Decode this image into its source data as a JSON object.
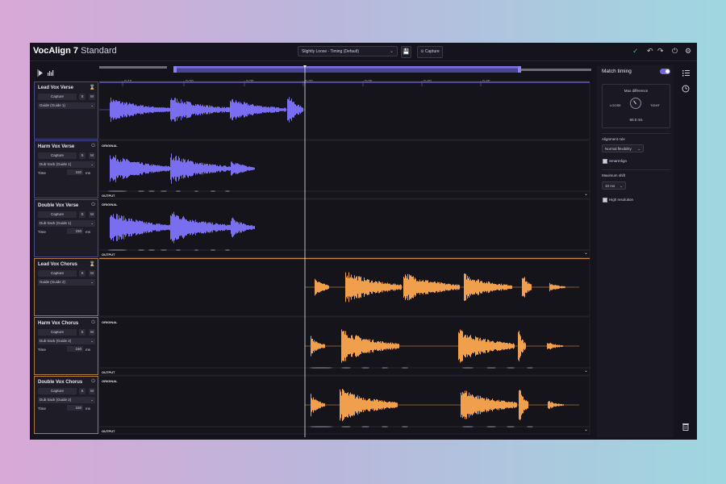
{
  "app": {
    "name_bold": "VocAlign 7",
    "edition": "Standard"
  },
  "toolbar": {
    "preset": "Slightly Loose - Timing (Default)",
    "capture_label": "⊙ Capture"
  },
  "ruler": {
    "ticks": [
      "0:15",
      "0:20",
      "0:25",
      "0:30",
      "0:35",
      "0:40",
      "0:45"
    ]
  },
  "tracks": [
    {
      "name": "Lead Vox Verse",
      "capture": "Capture",
      "solo": "S",
      "mute": "M",
      "guide": "Guide (Guide 1)",
      "icon": "hourglass-icon",
      "color": "#7a6ef0"
    },
    {
      "name": "Harm Vox Verse",
      "capture": "Capture",
      "solo": "S",
      "mute": "M",
      "guide": "Dub track (Guide 1)",
      "time_label": "Time",
      "time_value": "150",
      "time_unit": "ms",
      "icon": "power-icon",
      "color": "#7a6ef0"
    },
    {
      "name": "Double Vox Verse",
      "capture": "Capture",
      "solo": "S",
      "mute": "M",
      "guide": "Dub track (Guide 1)",
      "time_label": "Time",
      "time_value": "150",
      "time_unit": "ms",
      "icon": "power-icon",
      "color": "#7a6ef0"
    },
    {
      "name": "Lead Vox Chorus",
      "capture": "Capture",
      "solo": "S",
      "mute": "M",
      "guide": "Guide (Guide 2)",
      "icon": "hourglass-icon",
      "color": "#f0a04c"
    },
    {
      "name": "Harm Vox Chorus",
      "capture": "Capture",
      "solo": "S",
      "mute": "M",
      "guide": "Dub track (Guide 2)",
      "time_label": "Time",
      "time_value": "150",
      "time_unit": "ms",
      "icon": "power-icon",
      "color": "#f0a04c"
    },
    {
      "name": "Double Vox Chorus",
      "capture": "Capture",
      "solo": "S",
      "mute": "M",
      "guide": "Dub track (Guide 2)",
      "time_label": "Time",
      "time_value": "150",
      "time_unit": "ms",
      "icon": "power-icon",
      "color": "#f0a04c"
    }
  ],
  "lane_labels": {
    "original": "ORIGINAL",
    "output": "OUTPUT"
  },
  "panel": {
    "title": "Match timing",
    "max_diff_label": "Max difference",
    "loose": "LOOSE",
    "tight": "TIGHT",
    "max_diff_value": "50.0 ms",
    "alignment_rule_label": "Alignment rule",
    "alignment_rule_value": "Normal flexibility",
    "smartalign": "SmartAlign",
    "max_shift_label": "Maximum shift",
    "max_shift_value": "10 ms",
    "high_res": "High resolution"
  },
  "colors": {
    "purple": "#7a6ef0",
    "orange": "#f0a04c",
    "accent": "#6f67e8",
    "check": "#2fbf71"
  }
}
